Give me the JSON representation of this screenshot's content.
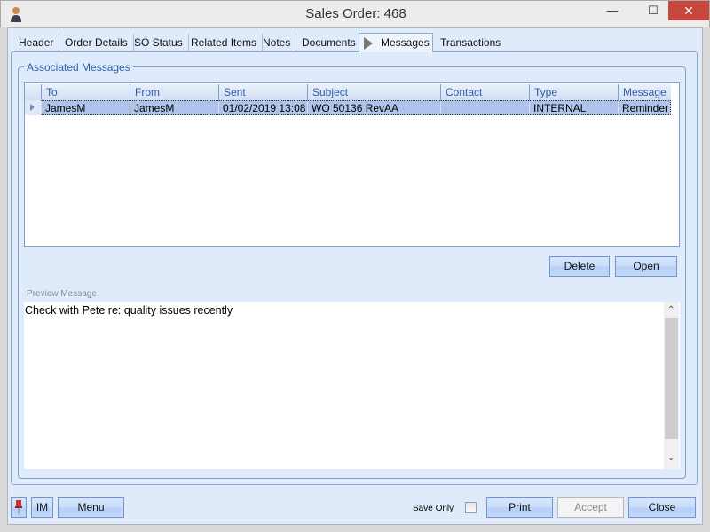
{
  "window": {
    "title": "Sales Order: 468",
    "minimize": "—",
    "maximize": "☐",
    "close": "✕"
  },
  "tabs": [
    {
      "label": "Header"
    },
    {
      "label": "Order Details"
    },
    {
      "label": "SO Status"
    },
    {
      "label": "Related Items"
    },
    {
      "label": "Notes"
    },
    {
      "label": "Documents"
    },
    {
      "label": "Messages"
    },
    {
      "label": "Transactions"
    }
  ],
  "associated": {
    "label": "Associated Messages",
    "columns": [
      "To",
      "From",
      "Sent",
      "Subject",
      "Contact",
      "Type",
      "Message"
    ],
    "rows": [
      {
        "to": "JamesM",
        "from": "JamesM",
        "sent": "01/02/2019 13:08",
        "subject": "WO 50136 RevAA",
        "contact": "",
        "type": "INTERNAL",
        "message": "Reminder"
      }
    ],
    "delete_label": "Delete",
    "open_label": "Open"
  },
  "preview": {
    "label": "Preview Message",
    "text": "Check with Pete re: quality issues recently"
  },
  "footer": {
    "im_label": "IM",
    "menu_label": "Menu",
    "save_only_label": "Save Only",
    "save_only_checked": false,
    "print_label": "Print",
    "accept_label": "Accept",
    "close_label": "Close"
  }
}
